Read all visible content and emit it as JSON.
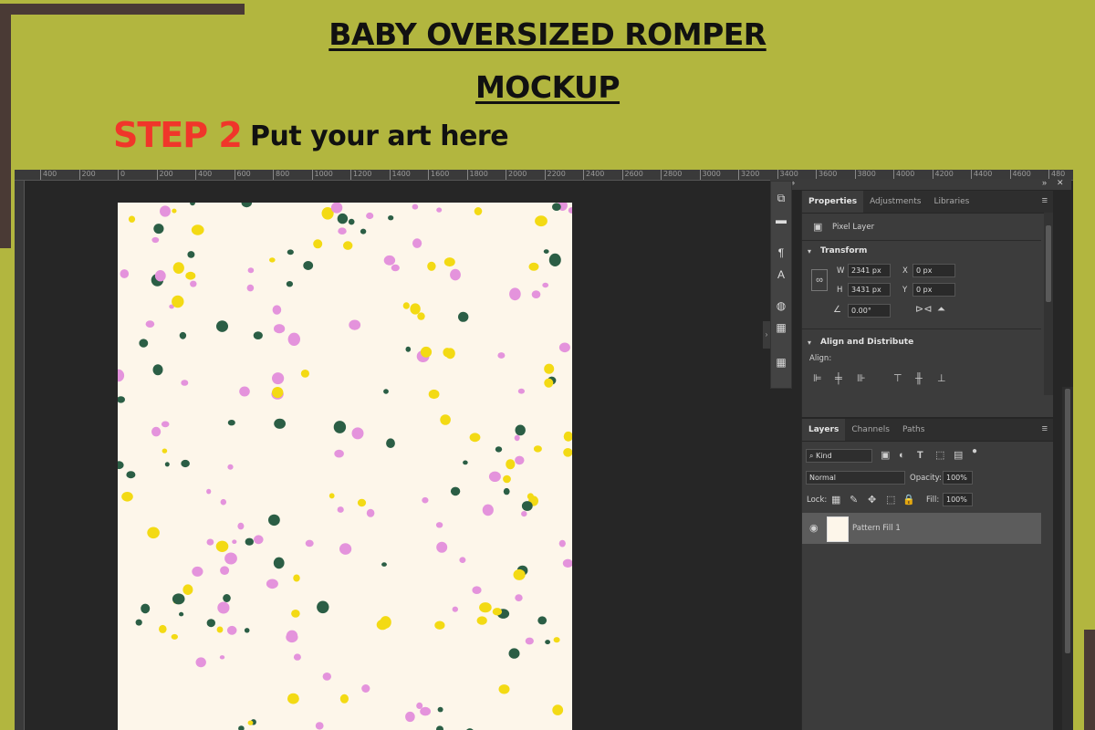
{
  "header": {
    "title_line1": "BABY OVERSIZED ROMPER",
    "title_line2": "MOCKUP",
    "step_label": "STEP 2",
    "step_text": "Put your art here"
  },
  "ruler": {
    "ticks": [
      "400",
      "200",
      "0",
      "200",
      "400",
      "600",
      "800",
      "1000",
      "1200",
      "1400",
      "1600",
      "1800",
      "2000",
      "2200",
      "2400",
      "2600",
      "2800",
      "3000",
      "3200",
      "3400",
      "3600",
      "3800",
      "4000",
      "4200",
      "4400",
      "4600",
      "480"
    ]
  },
  "properties_panel": {
    "tabs": [
      "Properties",
      "Adjustments",
      "Libraries"
    ],
    "layer_type": "Pixel Layer",
    "transform_title": "Transform",
    "w_label": "W",
    "w_value": "2341 px",
    "h_label": "H",
    "h_value": "3431 px",
    "x_label": "X",
    "x_value": "0 px",
    "y_label": "Y",
    "y_value": "0 px",
    "angle_value": "0.00°",
    "align_title": "Align and Distribute",
    "align_label": "Align:"
  },
  "layers_panel": {
    "tabs": [
      "Layers",
      "Channels",
      "Paths"
    ],
    "kind_label": "Kind",
    "blend_mode": "Normal",
    "opacity_label": "Opacity:",
    "opacity_value": "100%",
    "lock_label": "Lock:",
    "fill_label": "Fill:",
    "fill_value": "100%",
    "layer_name": "Pattern Fill 1"
  },
  "colors": {
    "background": "#b2b63f",
    "accent_red": "#f0362a",
    "dot_pink": "#e493dc",
    "dot_green": "#2b5e45",
    "dot_yellow": "#f3da14",
    "canvas": "#fdf6ea"
  },
  "icons": [
    "eye-icon",
    "chevron-down-icon",
    "menu-icon",
    "link-icon",
    "palette-icon",
    "grid-icon",
    "comment-icon"
  ]
}
